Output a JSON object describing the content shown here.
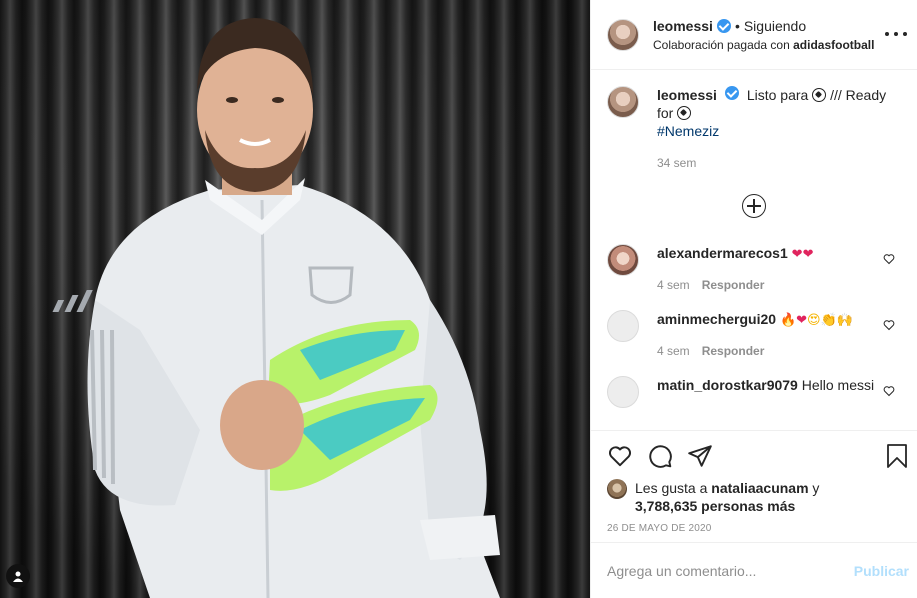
{
  "header": {
    "username": "leomessi",
    "separator": "•",
    "follow_status": "Siguiendo",
    "partnership_prefix": "Colaboración pagada con ",
    "partnership_brand": "adidasfootball"
  },
  "caption": {
    "username": "leomessi",
    "text_part1": "Listo para",
    "text_part2": "/// Ready for",
    "hashtag": "#Nemeziz",
    "age": "34 sem"
  },
  "comments": [
    {
      "username": "alexandermarecos1",
      "text": "",
      "emojis": [
        "❤",
        "❤"
      ],
      "age": "4 sem",
      "reply": "Responder"
    },
    {
      "username": "aminmechergui20",
      "text": "",
      "emojis": [
        "🔥",
        "❤",
        "😍",
        "👏",
        "🙌"
      ],
      "age": "4 sem",
      "reply": "Responder"
    },
    {
      "username": "matin_dorostkar9079",
      "text": "Hello messi",
      "emojis": [],
      "age": "",
      "reply": ""
    }
  ],
  "likes": {
    "prefix": "Les gusta a ",
    "user": "nataliaacunam",
    "connector": " y",
    "count": "3,788,635 personas más"
  },
  "date": "26 DE MAYO DE 2020",
  "add_comment": {
    "placeholder": "Agrega un comentario...",
    "publish_label": "Publicar"
  },
  "icons": {
    "more": "more-options-icon",
    "like": "heart-icon",
    "comment": "comment-icon",
    "share": "share-icon",
    "save": "bookmark-icon",
    "load_more": "plus-circle-icon",
    "tag": "user-tag-icon"
  },
  "colors": {
    "verified": "#3897f0",
    "hashtag": "#00376b",
    "publish_disabled": "#b2dffc",
    "muted": "#8e8e8e"
  }
}
